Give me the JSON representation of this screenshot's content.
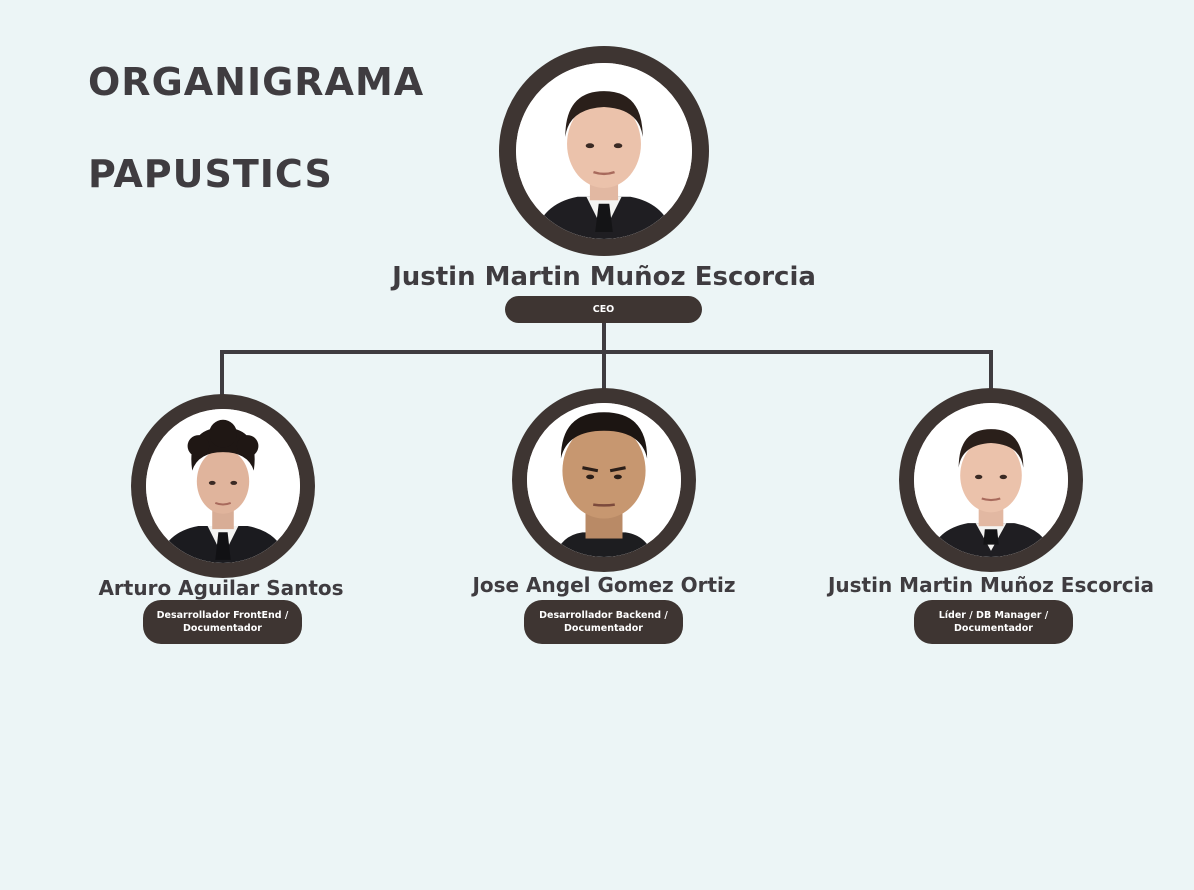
{
  "title": {
    "line1": "ORGANIGRAMA",
    "line2": "PAPUSTICS"
  },
  "colors": {
    "background": "#ecf5f6",
    "frame": "#3e3532",
    "connector": "#3f3c40",
    "text": "#3f3c40"
  },
  "root": {
    "name": "Justin Martin Muñoz Escorcia",
    "role": "CEO",
    "photo": "portrait-photo"
  },
  "members": [
    {
      "name": "Arturo Aguilar Santos",
      "role_line1": "Desarrollador FrontEnd /",
      "role_line2": "Documentador",
      "photo": "portrait-photo"
    },
    {
      "name": "Jose Angel Gomez Ortiz",
      "role_line1": "Desarrollador Backend /",
      "role_line2": "Documentador",
      "photo": "portrait-photo"
    },
    {
      "name": "Justin Martin Muñoz Escorcia",
      "role_line1": "Líder / DB Manager /",
      "role_line2": "Documentador",
      "photo": "portrait-photo"
    }
  ]
}
